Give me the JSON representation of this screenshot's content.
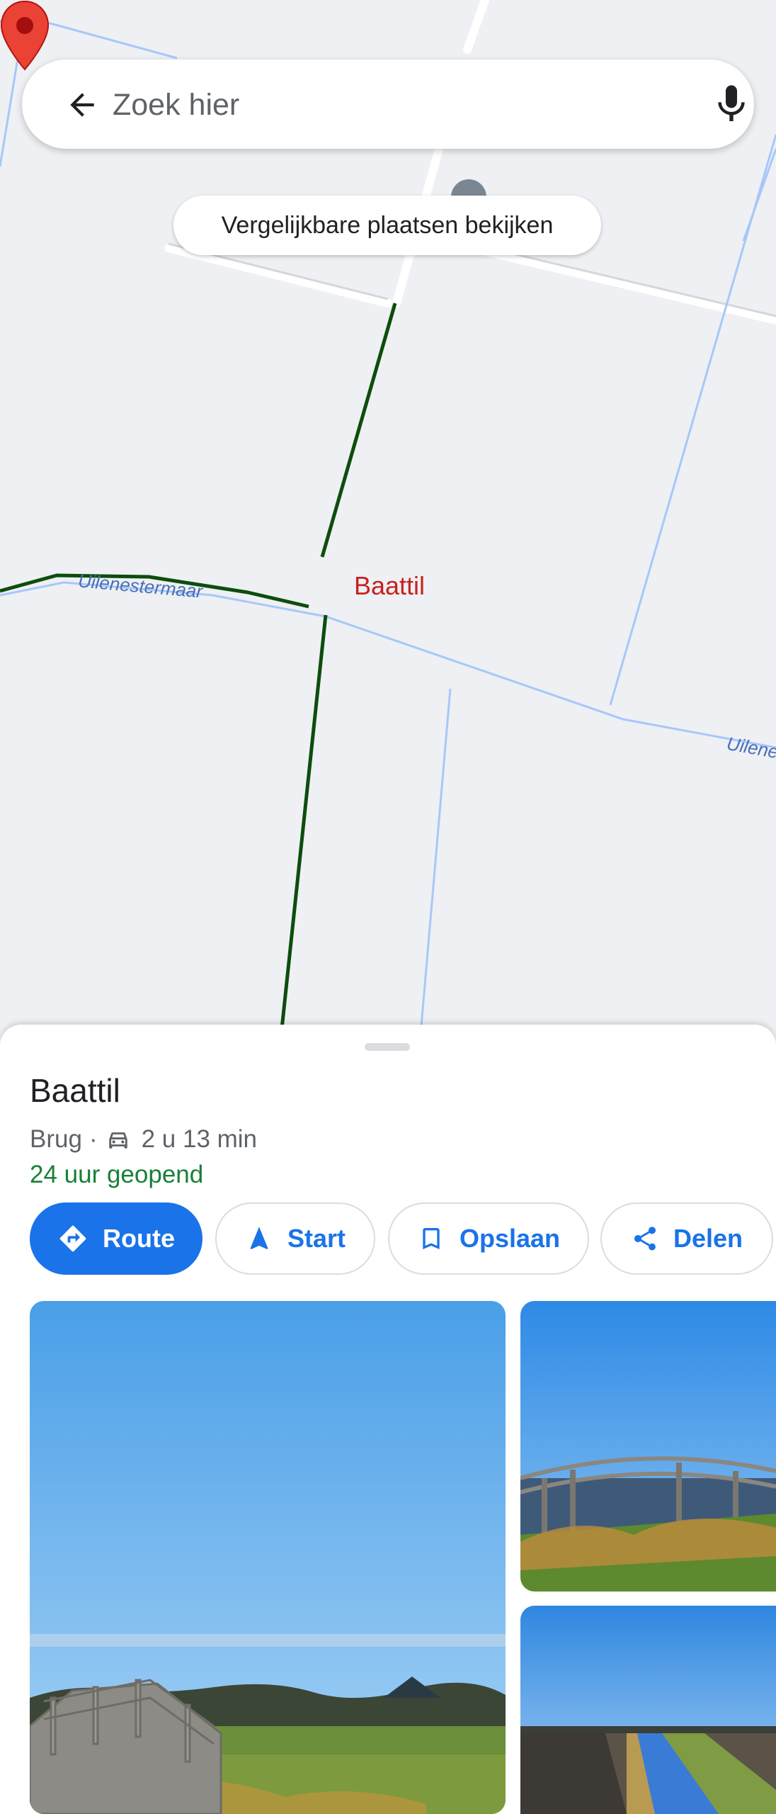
{
  "search": {
    "placeholder": "Zoek hier"
  },
  "chips": {
    "similar_places": "Vergelijkbare plaatsen bekijken"
  },
  "map": {
    "road_labels": [
      "Uilenestermaar",
      "Uilene"
    ],
    "marker_label": "Baattil",
    "colors": {
      "background": "#eef0f3",
      "water": "#a8c7fa",
      "path": "#0d4d0d",
      "marker": "#ea4335",
      "marker_label": "#c5221f"
    }
  },
  "place": {
    "name": "Baattil",
    "category": "Brug",
    "separator": "·",
    "travel_mode_icon": "car-icon",
    "travel_time": "2 u 13 min",
    "hours": "24 uur geopend"
  },
  "actions": {
    "route": "Route",
    "start": "Start",
    "save": "Opslaan",
    "share": "Delen"
  },
  "icons": {
    "back": "arrow-left-icon",
    "mic": "mic-icon",
    "route": "directions-icon",
    "start": "navigation-arrow-icon",
    "save": "bookmark-icon",
    "share": "share-icon"
  },
  "colors": {
    "accent": "#1a73e8",
    "open_status": "#188038"
  }
}
